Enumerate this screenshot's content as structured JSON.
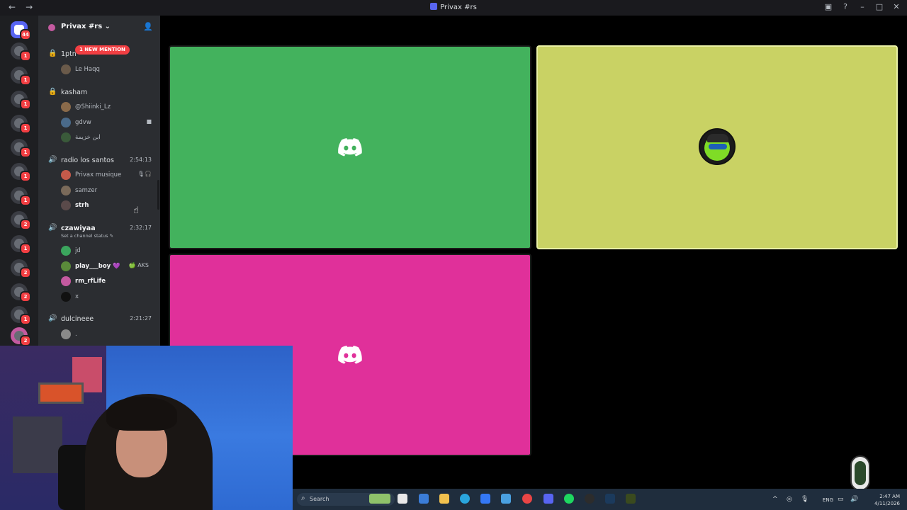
{
  "window": {
    "title": "Privax #rs",
    "back_icon": "arrow-left-icon",
    "forward_icon": "arrow-right-icon"
  },
  "rail": {
    "home_badge": "44",
    "servers": [
      {
        "badge": "1"
      },
      {
        "badge": "1"
      },
      {
        "badge": "1"
      },
      {
        "badge": "1"
      },
      {
        "badge": "1"
      },
      {
        "badge": "1"
      },
      {
        "badge": "1"
      },
      {
        "badge": "1"
      },
      {
        "badge": "2"
      },
      {
        "badge": "1"
      },
      {
        "badge": "2"
      },
      {
        "badge": "2"
      },
      {
        "badge": "1"
      },
      {
        "badge": "2"
      }
    ]
  },
  "sidebar": {
    "server_name": "Privax #rs ⌄",
    "new_mention": "1 NEW MENTION",
    "channels": [
      {
        "name": "1ptn",
        "icon": "lock-icon",
        "users": [
          {
            "name": "Le Haqq"
          }
        ]
      },
      {
        "name": "kasham",
        "icon": "lock-icon",
        "users": [
          {
            "name": "@Shiinki_Lz"
          },
          {
            "name": "gdvw"
          },
          {
            "name": "ابن خزيمة"
          }
        ]
      },
      {
        "name": "radio los santos",
        "icon": "speaker-icon",
        "time": "2:54:13",
        "users": [
          {
            "name": "Privax musique"
          },
          {
            "name": "samzer"
          },
          {
            "name": "strh"
          }
        ]
      },
      {
        "name": "czawiyaa",
        "icon": "speaker-icon",
        "time": "2:32:17",
        "status": "Set a channel status ✎",
        "users": [
          {
            "name": "jd"
          },
          {
            "name": "play___boy 💜",
            "extra": "🍏 AKS"
          },
          {
            "name": "rm_rfLife"
          },
          {
            "name": "x"
          }
        ]
      },
      {
        "name": "dulcineee",
        "icon": "speaker-icon",
        "time": "2:21:27",
        "users": [
          {
            "name": "."
          }
        ]
      }
    ]
  },
  "taskbar": {
    "search_placeholder": "Search",
    "lang": "ENG",
    "time": "2:47 AM",
    "date": "4/11/2026"
  },
  "colors": {
    "green_tile": "#43b25d",
    "yellow_tile": "#c9d264",
    "pink_tile": "#e0309a",
    "blurple": "#5865f2",
    "badge_red": "#f23f43"
  }
}
